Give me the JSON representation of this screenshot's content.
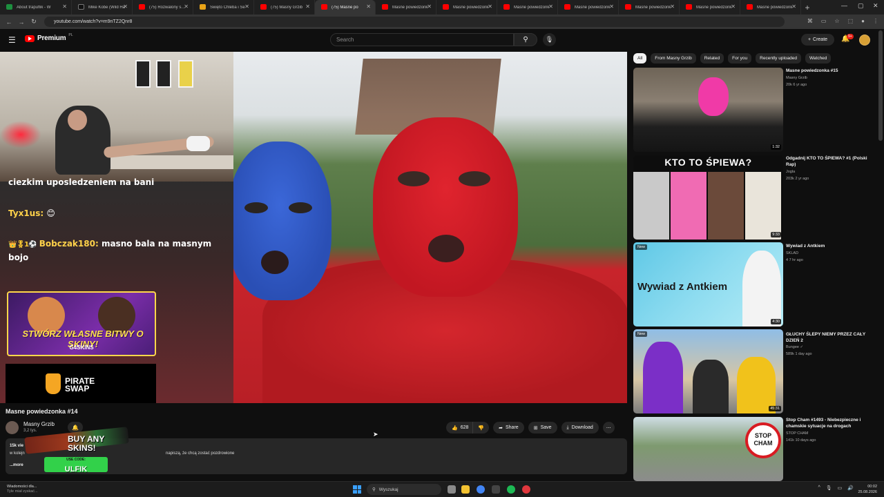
{
  "browser": {
    "tabs": [
      {
        "label": "About trapuflik - W",
        "icon": "excel-icon",
        "color": "#1d8f3f",
        "active": false
      },
      {
        "label": "Mike Kobe (Wild Ha",
        "icon": "x-icon",
        "color": "#111111",
        "active": false
      },
      {
        "label": "(75) Rozwalony syst",
        "icon": "youtube-icon",
        "color": "#ff0000",
        "active": false
      },
      {
        "label": "Święto Chleba i Se",
        "icon": "calendar-icon",
        "color": "#e8a317",
        "active": false
      },
      {
        "label": "(75) Masny Grzib",
        "icon": "youtube-icon",
        "color": "#ff0000",
        "active": false
      },
      {
        "label": "(75) Masne po",
        "icon": "youtube-icon",
        "color": "#ff0000",
        "active": true
      },
      {
        "label": "Masne powiedzonk",
        "icon": "youtube-icon",
        "color": "#ff0000",
        "active": false
      },
      {
        "label": "Masne powiedzonk",
        "icon": "youtube-icon",
        "color": "#ff0000",
        "active": false
      },
      {
        "label": "Masne powiedzonk",
        "icon": "youtube-icon",
        "color": "#ff0000",
        "active": false
      },
      {
        "label": "Masne powiedzonk",
        "icon": "youtube-icon",
        "color": "#ff0000",
        "active": false
      },
      {
        "label": "Masne powiedzonk",
        "icon": "youtube-icon",
        "color": "#ff0000",
        "active": false
      },
      {
        "label": "Masne powiedzonk",
        "icon": "youtube-icon",
        "color": "#ff0000",
        "active": false
      },
      {
        "label": "Masne powiedzonk",
        "icon": "youtube-icon",
        "color": "#ff0000",
        "active": false
      }
    ],
    "url": "youtube.com/watch?v=m9nTZ2Qnr8"
  },
  "youtube": {
    "logo_text": "Premium",
    "logo_region": "PL",
    "search_placeholder": "Search",
    "create_label": "Create",
    "notifications_badge": "9+"
  },
  "player": {
    "chat": {
      "cut_text": "ciezkim uposledzeniem na bani",
      "messages": [
        {
          "user": "Tyx1us:",
          "text": " 😊",
          "badges": ""
        },
        {
          "user": "Bobczak180:",
          "text": " masno bala na masnym bojo",
          "badges": "👑🎖1⚽"
        }
      ]
    },
    "promo_skins": {
      "title": "STWÓRZ WŁASNE BITWY O SKINY!",
      "brand": "G4SKINS"
    },
    "promo_pirate": {
      "line1": "PIRATE",
      "line2": "SWAP"
    },
    "promo_buy": {
      "line1": "BUY ANY",
      "line2": "SKINS!",
      "code_label": "USE CODE:",
      "code": "ULFIK"
    }
  },
  "video": {
    "title": "Masne powiedzonka #14",
    "channel": "Masny Grzib",
    "subscribers": "3,2 tys.",
    "likes": "628",
    "share_label": "Share",
    "save_label": "Save",
    "download_label": "Download",
    "views": "15k vie",
    "desc_line1": "w kolejn",
    "desc_line2": "napiszą, że chcą zostać pozdrowione",
    "more_label": "...more"
  },
  "sidebar": {
    "chips": [
      {
        "label": "All",
        "active": true
      },
      {
        "label": "From Masny Grzib",
        "active": false
      },
      {
        "label": "Related",
        "active": false
      },
      {
        "label": "For you",
        "active": false
      },
      {
        "label": "Recently uploaded",
        "active": false
      },
      {
        "label": "Watched",
        "active": false
      }
    ],
    "recommendations": [
      {
        "title": "Masne powiedzonka #15",
        "channel": "Masny Grzib",
        "meta": "20k  6 yr ago",
        "duration": "1:32",
        "new": ""
      },
      {
        "title": "Odgadnij KTO TO ŚPIEWA? #1 (Polski Rap)",
        "channel": "Jogla",
        "meta": "203k  2 yr ago",
        "duration": "9:33",
        "new": "",
        "thumb_text": "KTO TO ŚPIEWA?"
      },
      {
        "title": "Wywiad z Antkiem",
        "channel": "SKLAD",
        "meta": "4  7 hr ago",
        "duration": "4:30",
        "new": "New",
        "thumb_text": "Wywiad z Antkiem"
      },
      {
        "title": "GŁUCHY ŚLEPY NIEMY PRZEZ CAŁY DZIEŃ 2",
        "channel": "Bungee ✓",
        "meta": "589k  1 day ago",
        "duration": "45:31",
        "new": "New"
      },
      {
        "title": "Stop Cham #1493 - Niebezpieczne i chamskie sytuacje na drogach",
        "channel": "STOP CHAM",
        "meta": "141k  10 days ago",
        "duration": "",
        "new": "",
        "thumb_text": "STOP CHAM"
      }
    ]
  },
  "taskbar": {
    "news_title": "Wiadomości dla...",
    "news_sub": "Tyle miał zyskać...",
    "search_label": "Wyszukaj",
    "time": "00:02",
    "date": "25.08.2026"
  }
}
